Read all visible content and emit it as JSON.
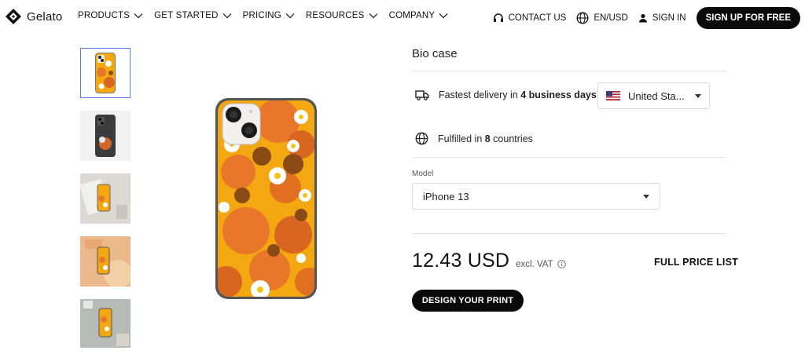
{
  "brand": {
    "name": "Gelato"
  },
  "nav": {
    "items": [
      {
        "label": "PRODUCTS"
      },
      {
        "label": "GET STARTED"
      },
      {
        "label": "PRICING"
      },
      {
        "label": "RESOURCES"
      },
      {
        "label": "COMPANY"
      }
    ],
    "contact_label": "CONTACT US",
    "locale_label": "EN/USD",
    "signin_label": "SIGN IN",
    "signup_label": "SIGN UP FOR FREE"
  },
  "product": {
    "title": "Bio case",
    "delivery_prefix": "Fastest delivery in ",
    "delivery_bold": "4 business days",
    "country_value": "United Sta...",
    "fulfilled_prefix": "Fulfilled in ",
    "fulfilled_bold": "8",
    "fulfilled_suffix": " countries",
    "model_label": "Model",
    "model_value": "iPhone 13",
    "price": "12.43 USD",
    "price_note": "excl. VAT",
    "full_price_label": "FULL PRICE LIST",
    "cta_label": "DESIGN YOUR PRINT"
  },
  "colors": {
    "accent": "#0a0a0a",
    "thumb_active_border": "#5b7cf0",
    "case_orange": "#e8772a",
    "case_yellow": "#f3a812"
  },
  "icons": [
    "gelato-logo-icon",
    "chevron-down-icon",
    "headset-icon",
    "globe-icon",
    "user-icon",
    "truck-icon",
    "flag-us-icon",
    "caret-down-icon",
    "info-icon"
  ]
}
